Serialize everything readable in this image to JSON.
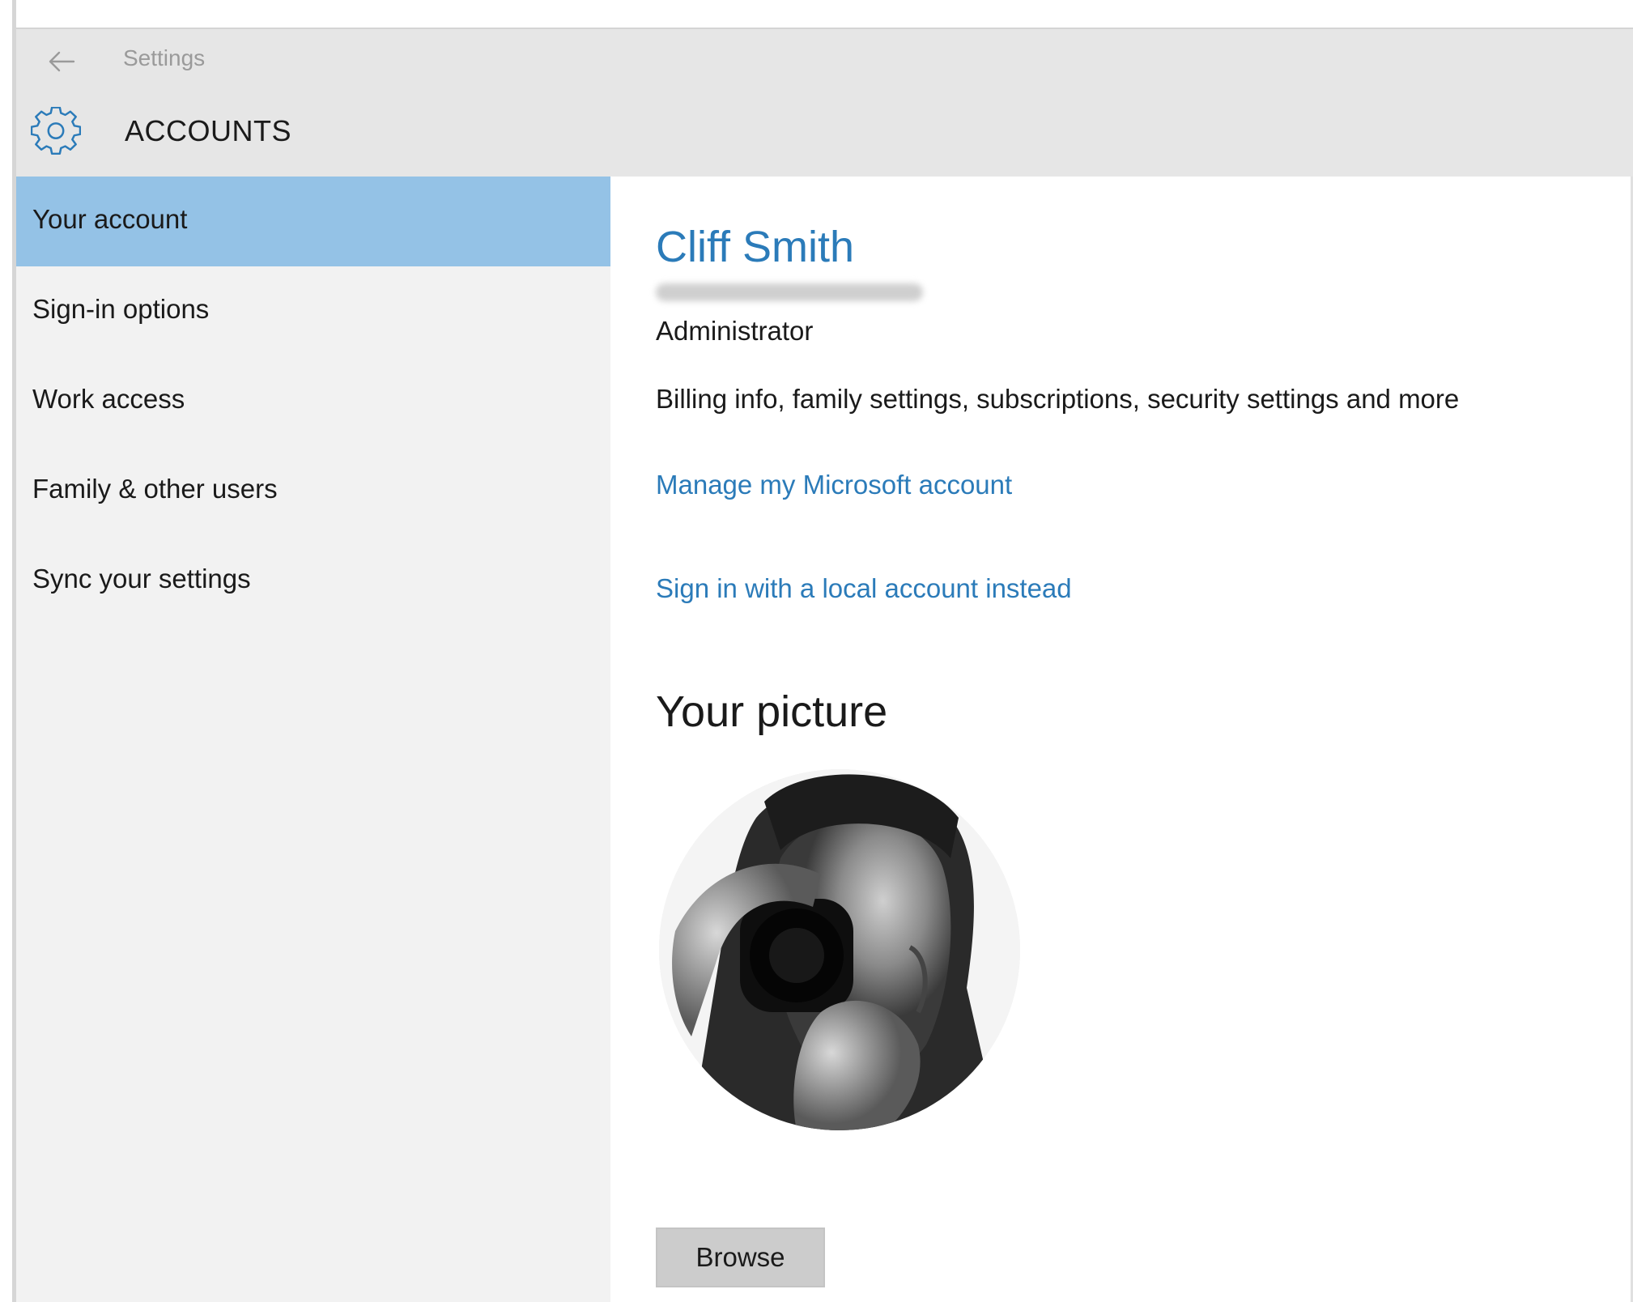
{
  "titlebar": {
    "title": "Settings",
    "back_icon": "arrow-left-icon"
  },
  "header": {
    "icon": "gear-icon",
    "title": "ACCOUNTS"
  },
  "sidebar": {
    "selected_index": 0,
    "items": [
      {
        "label": "Your account"
      },
      {
        "label": "Sign-in options"
      },
      {
        "label": "Work access"
      },
      {
        "label": "Family & other users"
      },
      {
        "label": "Sync your settings"
      }
    ]
  },
  "account": {
    "name": "Cliff Smith",
    "role": "Administrator",
    "billing_description": "Billing info, family settings, subscriptions, security settings and more",
    "manage_link": "Manage my Microsoft account",
    "local_account_link": "Sign in with a local account instead"
  },
  "picture": {
    "heading": "Your picture",
    "browse_label": "Browse"
  },
  "colors": {
    "accent": "#2b7bb9",
    "selected_nav": "#94c2e6",
    "header_bg": "#e6e6e6",
    "sidebar_bg": "#f2f2f2"
  }
}
